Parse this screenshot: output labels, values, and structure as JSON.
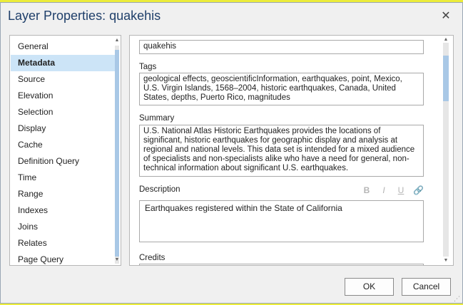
{
  "dialog": {
    "title": "Layer Properties: quakehis",
    "close_glyph": "✕"
  },
  "nav": {
    "items": [
      {
        "label": "General",
        "active": false
      },
      {
        "label": "Metadata",
        "active": true
      },
      {
        "label": "Source",
        "active": false
      },
      {
        "label": "Elevation",
        "active": false
      },
      {
        "label": "Selection",
        "active": false
      },
      {
        "label": "Display",
        "active": false
      },
      {
        "label": "Cache",
        "active": false
      },
      {
        "label": "Definition Query",
        "active": false
      },
      {
        "label": "Time",
        "active": false
      },
      {
        "label": "Range",
        "active": false
      },
      {
        "label": "Indexes",
        "active": false
      },
      {
        "label": "Joins",
        "active": false
      },
      {
        "label": "Relates",
        "active": false
      },
      {
        "label": "Page Query",
        "active": false
      }
    ]
  },
  "metadata": {
    "title_value": "quakehis",
    "tags_label": "Tags",
    "tags_value": "geological effects, geoscientificInformation, earthquakes, point, Mexico, U.S. Virgin Islands, 1568–2004, historic earthquakes, Canada, United States, depths, Puerto Rico, magnitudes",
    "summary_label": "Summary",
    "summary_value": "U.S. National Atlas Historic Earthquakes provides the locations of significant, historic earthquakes for geographic display and analysis at regional and national levels. This data set is intended for a mixed audience of specialists and non-specialists alike who have a need for general, non-technical information about significant U.S. earthquakes.",
    "description_label": "Description",
    "description_value": "Earthquakes registered within the State of California",
    "credits_label": "Credits",
    "format_buttons": {
      "bold": "B",
      "italic": "I",
      "underline": "U"
    }
  },
  "buttons": {
    "ok": "OK",
    "cancel": "Cancel"
  },
  "colors": {
    "accent": "#1f3f6a",
    "selection": "#cce4f7",
    "scroll_thumb": "#a9c8e6",
    "map_yellow": "#ecec3a"
  }
}
